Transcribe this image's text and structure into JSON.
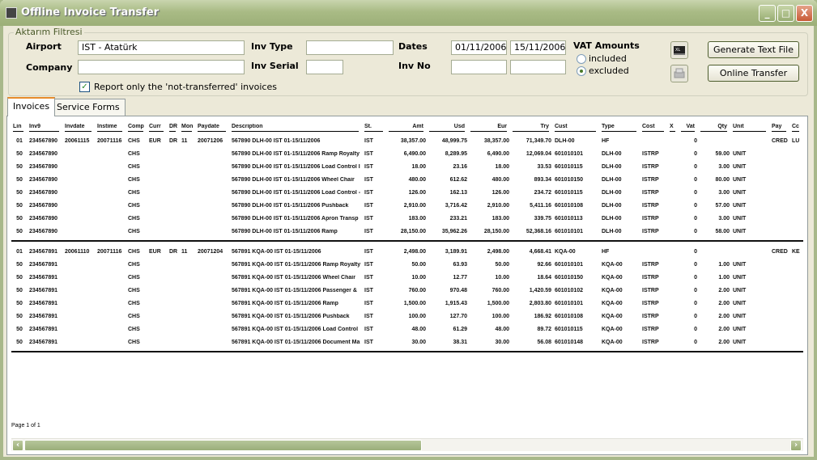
{
  "window": {
    "title": "Offline Invoice Transfer",
    "min": "_",
    "max": "□",
    "close": "X"
  },
  "filter": {
    "legend": "Aktarım Filtresi",
    "airport_label": "Airport",
    "airport_value": "IST - Atatürk",
    "company_label": "Company",
    "company_value": "",
    "invtype_label": "Inv Type",
    "invtype_value": "",
    "invserial_label": "Inv Serial",
    "invserial_value": "",
    "dates_label": "Dates",
    "date_from": "01/11/2006",
    "date_to": "15/11/2006",
    "invno_label": "Inv No",
    "invno_from": "",
    "invno_to": "",
    "vat_label": "VAT Amounts",
    "vat_options": [
      "included",
      "excluded"
    ],
    "vat_selected": "excluded",
    "report_only_label": "Report only the 'not-transferred' invoices",
    "report_only_checked": true,
    "generate_button": "Generate Text File",
    "online_button": "Online Transfer",
    "icons": [
      "excel-export-icon",
      "print-icon"
    ]
  },
  "tabs": [
    {
      "label": "Invoices",
      "active": true
    },
    {
      "label": "Service Forms",
      "active": false
    }
  ],
  "grid": {
    "columns": [
      "Lin",
      "Inv9",
      "Invdate",
      "Instime",
      "Comp",
      "Curr",
      "DR",
      "Mon",
      "Paydate",
      "Description",
      "St.",
      "Amt",
      "Usd",
      "Eur",
      "Try",
      "Cust",
      "Type",
      "Cost",
      "X",
      "Vat",
      "Qty",
      "Unit",
      "Pay",
      "Cc"
    ],
    "groups": [
      [
        [
          "01",
          "234567890",
          "20061115",
          "20071116",
          "CHS",
          "EUR",
          "DR",
          "11",
          "20071206",
          "567890 DLH-00 IST 01-15/11/2006",
          "IST",
          "38,357.00",
          "48,999.75",
          "38,357.00",
          "71,349.70",
          "DLH-00",
          "HF",
          "",
          "",
          "0",
          "",
          "",
          "CRED",
          "LU"
        ],
        [
          "50",
          "234567890",
          "",
          "",
          "CHS",
          "",
          "",
          "",
          "",
          "567890 DLH-00 IST 01-15/11/2006 Ramp Royalty",
          "IST",
          "6,490.00",
          "8,289.95",
          "6,490.00",
          "12,069.04",
          "601010101",
          "DLH-00",
          "ISTRP",
          "",
          "0",
          "59.00",
          "UNIT",
          "",
          ""
        ],
        [
          "50",
          "234567890",
          "",
          "",
          "CHS",
          "",
          "",
          "",
          "",
          "567890 DLH-00 IST 01-15/11/2006 Load Control I",
          "IST",
          "18.00",
          "23.16",
          "18.00",
          "33.53",
          "601010115",
          "DLH-00",
          "ISTRP",
          "",
          "0",
          "3.00",
          "UNIT",
          "",
          ""
        ],
        [
          "50",
          "234567890",
          "",
          "",
          "CHS",
          "",
          "",
          "",
          "",
          "567890 DLH-00 IST 01-15/11/2006 Wheel Chair",
          "IST",
          "480.00",
          "612.62",
          "480.00",
          "893.34",
          "601010150",
          "DLH-00",
          "ISTRP",
          "",
          "0",
          "80.00",
          "UNIT",
          "",
          ""
        ],
        [
          "50",
          "234567890",
          "",
          "",
          "CHS",
          "",
          "",
          "",
          "",
          "567890 DLH-00 IST 01-15/11/2006 Load Control -",
          "IST",
          "126.00",
          "162.13",
          "126.00",
          "234.72",
          "601010115",
          "DLH-00",
          "ISTRP",
          "",
          "0",
          "3.00",
          "UNIT",
          "",
          ""
        ],
        [
          "50",
          "234567890",
          "",
          "",
          "CHS",
          "",
          "",
          "",
          "",
          "567890 DLH-00 IST 01-15/11/2006 Pushback",
          "IST",
          "2,910.00",
          "3,716.42",
          "2,910.00",
          "5,411.16",
          "601010108",
          "DLH-00",
          "ISTRP",
          "",
          "0",
          "57.00",
          "UNIT",
          "",
          ""
        ],
        [
          "50",
          "234567890",
          "",
          "",
          "CHS",
          "",
          "",
          "",
          "",
          "567890 DLH-00 IST 01-15/11/2006 Apron Transp",
          "IST",
          "183.00",
          "233.21",
          "183.00",
          "339.75",
          "601010113",
          "DLH-00",
          "ISTRP",
          "",
          "0",
          "3.00",
          "UNIT",
          "",
          ""
        ],
        [
          "50",
          "234567890",
          "",
          "",
          "CHS",
          "",
          "",
          "",
          "",
          "567890 DLH-00 IST 01-15/11/2006 Ramp",
          "IST",
          "28,150.00",
          "35,962.26",
          "28,150.00",
          "52,368.16",
          "601010101",
          "DLH-00",
          "ISTRP",
          "",
          "0",
          "58.00",
          "UNIT",
          "",
          ""
        ]
      ],
      [
        [
          "01",
          "234567891",
          "20061110",
          "20071116",
          "CHS",
          "EUR",
          "DR",
          "11",
          "20071204",
          "567891 KQA-00 IST 01-15/11/2006",
          "IST",
          "2,498.00",
          "3,189.91",
          "2,498.00",
          "4,668.41",
          "KQA-00",
          "HF",
          "",
          "",
          "0",
          "",
          "",
          "CRED",
          "KE"
        ],
        [
          "50",
          "234567891",
          "",
          "",
          "CHS",
          "",
          "",
          "",
          "",
          "567891 KQA-00 IST 01-15/11/2006 Ramp Royalty",
          "IST",
          "50.00",
          "63.93",
          "50.00",
          "92.66",
          "601010101",
          "KQA-00",
          "ISTRP",
          "",
          "0",
          "1.00",
          "UNIT",
          "",
          ""
        ],
        [
          "50",
          "234567891",
          "",
          "",
          "CHS",
          "",
          "",
          "",
          "",
          "567891 KQA-00 IST 01-15/11/2006 Wheel Chair",
          "IST",
          "10.00",
          "12.77",
          "10.00",
          "18.64",
          "601010150",
          "KQA-00",
          "ISTRP",
          "",
          "0",
          "1.00",
          "UNIT",
          "",
          ""
        ],
        [
          "50",
          "234567891",
          "",
          "",
          "CHS",
          "",
          "",
          "",
          "",
          "567891 KQA-00 IST 01-15/11/2006 Passenger &",
          "IST",
          "760.00",
          "970.48",
          "760.00",
          "1,420.59",
          "601010102",
          "KQA-00",
          "ISTRP",
          "",
          "0",
          "2.00",
          "UNIT",
          "",
          ""
        ],
        [
          "50",
          "234567891",
          "",
          "",
          "CHS",
          "",
          "",
          "",
          "",
          "567891 KQA-00 IST 01-15/11/2006 Ramp",
          "IST",
          "1,500.00",
          "1,915.43",
          "1,500.00",
          "2,803.80",
          "601010101",
          "KQA-00",
          "ISTRP",
          "",
          "0",
          "2.00",
          "UNIT",
          "",
          ""
        ],
        [
          "50",
          "234567891",
          "",
          "",
          "CHS",
          "",
          "",
          "",
          "",
          "567891 KQA-00 IST 01-15/11/2006 Pushback",
          "IST",
          "100.00",
          "127.70",
          "100.00",
          "186.92",
          "601010108",
          "KQA-00",
          "ISTRP",
          "",
          "0",
          "2.00",
          "UNIT",
          "",
          ""
        ],
        [
          "50",
          "234567891",
          "",
          "",
          "CHS",
          "",
          "",
          "",
          "",
          "567891 KQA-00 IST 01-15/11/2006 Load Control",
          "IST",
          "48.00",
          "61.29",
          "48.00",
          "89.72",
          "601010115",
          "KQA-00",
          "ISTRP",
          "",
          "0",
          "2.00",
          "UNIT",
          "",
          ""
        ],
        [
          "50",
          "234567891",
          "",
          "",
          "CHS",
          "",
          "",
          "",
          "",
          "567891 KQA-00 IST 01-15/11/2006 Document Ma",
          "IST",
          "30.00",
          "38.31",
          "30.00",
          "56.08",
          "601010148",
          "KQA-00",
          "ISTRP",
          "",
          "0",
          "2.00",
          "UNIT",
          "",
          ""
        ]
      ]
    ],
    "page_label": "Page 1 of 1"
  },
  "scrollbar": {
    "left": "‹",
    "right": "›",
    "grip": "|||"
  }
}
